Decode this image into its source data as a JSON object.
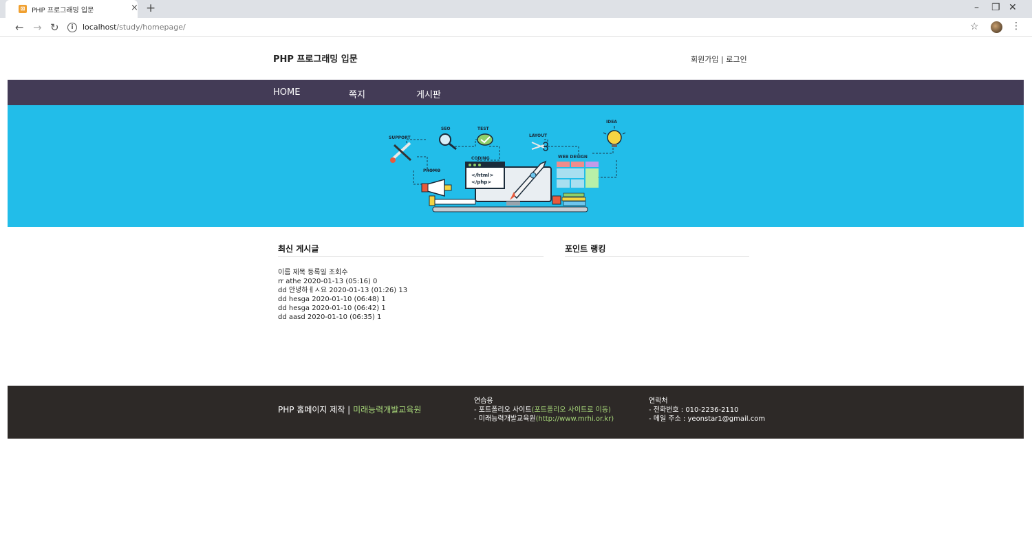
{
  "browser": {
    "tab_title": "PHP 프로그래밍 입문",
    "close_glyph": "×",
    "new_tab_glyph": "+",
    "url_host": "localhost",
    "url_path": "/study/homepage/",
    "window": {
      "minimize": "–",
      "restore": "❐",
      "close": "✕"
    }
  },
  "header": {
    "site_title": "PHP 프로그래밍 입문",
    "signup": "회원가입",
    "separator": "|",
    "login": "로그인"
  },
  "nav": {
    "items": [
      "HOME",
      "쪽지",
      "게시판"
    ]
  },
  "hero": {
    "labels": {
      "support": "SUPPORT",
      "seo": "SEO",
      "test": "TEST",
      "layout": "LAYOUT",
      "idea": "IDEA",
      "promo": "PROMO",
      "coding": "CODING",
      "web_design": "WEB DESIGN",
      "code_line1": "</html>",
      "code_line2": "</php>"
    }
  },
  "latest": {
    "title": "최신 게시글",
    "header": "이름 제목 등록일 조회수",
    "rows": [
      "rr athe 2020-01-13 (05:16) 0",
      "dd 안녕하ㅔㅅ요 2020-01-13 (01:26) 13",
      "dd hesga 2020-01-10 (06:48) 1",
      "dd hesga 2020-01-10 (06:42) 1",
      "dd aasd 2020-01-10 (06:35) 1"
    ]
  },
  "ranking": {
    "title": "포인트 랭킹"
  },
  "footer": {
    "brand_prefix": "PHP 홈페이지 제작 |",
    "brand_highlight": "미래능력개발교육원",
    "col1_title": "연습용",
    "col1_line1_prefix": "- 포트폴리오 사이트",
    "col1_line1_link": "(포트폴리오 사이트로 이동)",
    "col1_line2_prefix": "- 미래능력개발교육원",
    "col1_line2_link": "(http://www.mrhi.or.kr)",
    "col2_title": "연락처",
    "col2_line1": "- 전화번호 : 010-2236-2110",
    "col2_line2": "- 메일 주소 : yeonstar1@gmail.com"
  },
  "colors": {
    "nav_bg": "#433b56",
    "hero_bg": "#22bde9",
    "footer_bg": "#2d2927",
    "footer_accent": "#a8d87a"
  }
}
